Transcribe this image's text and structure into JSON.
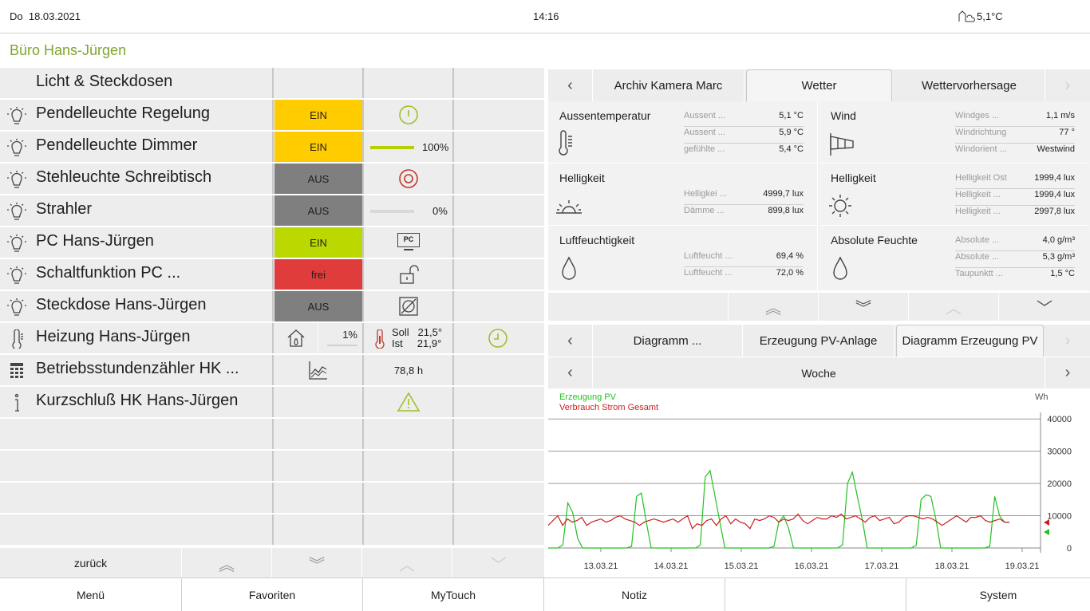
{
  "topbar": {
    "day": "Do",
    "date": "18.03.2021",
    "time": "14:16",
    "outdoor_temp": "5,1°C"
  },
  "room_title": "Büro Hans-Jürgen",
  "section_header": "Licht & Steckdosen",
  "rows": [
    {
      "label": "Pendelleuchte Regelung",
      "state": "EIN"
    },
    {
      "label": "Pendelleuchte Dimmer",
      "state": "EIN",
      "dim": "100%",
      "dim_level": 1.0
    },
    {
      "label": "Stehleuchte Schreibtisch",
      "state": "AUS"
    },
    {
      "label": "Strahler",
      "state": "AUS",
      "dim": "0%",
      "dim_level": 0.0
    },
    {
      "label": "PC Hans-Jürgen",
      "state": "EIN",
      "pc_label": "PC"
    },
    {
      "label": "Schaltfunktion PC ...",
      "state": "frei"
    },
    {
      "label": "Steckdose Hans-Jürgen",
      "state": "AUS"
    },
    {
      "label": "Heizung Hans-Jürgen",
      "valve": "1%",
      "soll_label": "Soll",
      "soll": "21,5°",
      "ist_label": "Ist",
      "ist": "21,9°"
    },
    {
      "label": "Betriebsstundenzähler HK ...",
      "hours": "78,8 h"
    },
    {
      "label": "Kurzschluß HK Hans-Jürgen"
    }
  ],
  "leftnav": {
    "back": "zurück"
  },
  "weather_tabs": [
    "Archiv Kamera Marc",
    "Wetter",
    "Wettervorhersage"
  ],
  "weather": {
    "aussen": {
      "title": "Aussentemperatur",
      "vals": [
        [
          "Aussent ...",
          "5,1 °C"
        ],
        [
          "Aussent ...",
          "5,9 °C"
        ],
        [
          "gefühlte ...",
          "5,4 °C"
        ]
      ]
    },
    "wind": {
      "title": "Wind",
      "vals": [
        [
          "Windges ...",
          "1,1 m/s"
        ],
        [
          "Windrichtung",
          "77 °"
        ],
        [
          "Windorient ...",
          "Westwind"
        ]
      ]
    },
    "hell1": {
      "title": "Helligkeit",
      "vals": [
        [
          "Helligkei ...",
          "4999,7 lux"
        ],
        [
          "Dämme ...",
          "899,8 lux"
        ]
      ]
    },
    "hell2": {
      "title": "Helligkeit",
      "vals": [
        [
          "Helligkeit Ost",
          "1999,4 lux"
        ],
        [
          "Helligkeit ...",
          "1999,4 lux"
        ],
        [
          "Helligkeit ...",
          "2997,8 lux"
        ]
      ]
    },
    "feucht": {
      "title": "Luftfeuchtigkeit",
      "vals": [
        [
          "Luftfeucht ...",
          "69,4 %"
        ],
        [
          "Luftfeucht ...",
          "72,0 %"
        ]
      ]
    },
    "absfeucht": {
      "title": "Absolute Feuchte",
      "vals": [
        [
          "Absolute ...",
          "4,0 g/m³"
        ],
        [
          "Absolute ...",
          "5,3 g/m³"
        ],
        [
          "Taupunktt ...",
          "1,5 °C"
        ]
      ]
    }
  },
  "diagram_tabs": [
    "Diagramm ...",
    "Erzeugung PV-Anlage",
    "Diagramm Erzeugung PV"
  ],
  "period": "Woche",
  "chart_data": {
    "type": "line",
    "unit": "Wh",
    "ylim": [
      0,
      45000
    ],
    "yticks": [
      "40000",
      "30000",
      "20000",
      "10000",
      "0"
    ],
    "xticks": [
      "13.03.21",
      "14.03.21",
      "15.03.21",
      "16.03.21",
      "17.03.21",
      "18.03.21",
      "19.03.21"
    ],
    "series": [
      {
        "name": "Erzeugung PV",
        "color": "#22c222",
        "values": [
          0,
          0,
          0,
          1000,
          14000,
          11000,
          3000,
          0,
          0,
          0,
          0,
          0,
          0,
          0,
          0,
          0,
          0,
          500,
          16000,
          17000,
          8000,
          0,
          0,
          0,
          0,
          0,
          0,
          0,
          0,
          0,
          0,
          900,
          22000,
          24000,
          16000,
          8000,
          0,
          0,
          0,
          0,
          0,
          0,
          0,
          0,
          0,
          0,
          500,
          8000,
          10000,
          6000,
          0,
          0,
          0,
          0,
          0,
          0,
          0,
          0,
          0,
          0,
          1000,
          20000,
          23500,
          16000,
          9000,
          0,
          0,
          0,
          0,
          0,
          0,
          0,
          0,
          0,
          0,
          800,
          15000,
          16500,
          16000,
          9000,
          0,
          0,
          0,
          0,
          0,
          0,
          0,
          0,
          0,
          0,
          500,
          16000,
          10000,
          8000,
          8000
        ]
      },
      {
        "name": "Verbrauch Strom Gesamt",
        "color": "#cc1e1e",
        "values": [
          7000,
          8500,
          10000,
          7000,
          9000,
          8000,
          8500,
          9500,
          7000,
          8000,
          8500,
          9000,
          8000,
          8500,
          9500,
          10000,
          9000,
          8500,
          8000,
          7000,
          8000,
          8500,
          9000,
          8500,
          8000,
          8500,
          9000,
          8000,
          9000,
          10000,
          6000,
          7500,
          7000,
          8500,
          9000,
          7000,
          9000,
          10000,
          7500,
          9000,
          8000,
          7500,
          6000,
          9000,
          8500,
          9000,
          10000,
          9500,
          8000,
          9000,
          8500,
          9000,
          10500,
          8500,
          7500,
          8500,
          9500,
          9000,
          9000,
          10000,
          9500,
          10500,
          9000,
          9500,
          10000,
          9000,
          8000,
          9500,
          10000,
          8500,
          9000,
          9500,
          7500,
          8000,
          9500,
          10000,
          10000,
          9500,
          9000,
          9500,
          9000,
          8000,
          7000,
          8000,
          9000,
          10000,
          9000,
          8000,
          9500,
          9500,
          10000,
          8500,
          8000,
          8500,
          9000,
          8000,
          8000
        ]
      }
    ]
  },
  "bottomnav": [
    "Menü",
    "Favoriten",
    "MyTouch",
    "Notiz",
    "",
    "System"
  ],
  "colors": {
    "ein": "#ffcc00",
    "aus": "#7f7f7f",
    "pc_ein": "#bbd800",
    "frei": "#e03c3c",
    "accent": "#9fbf2a",
    "red": "#c0392b"
  }
}
